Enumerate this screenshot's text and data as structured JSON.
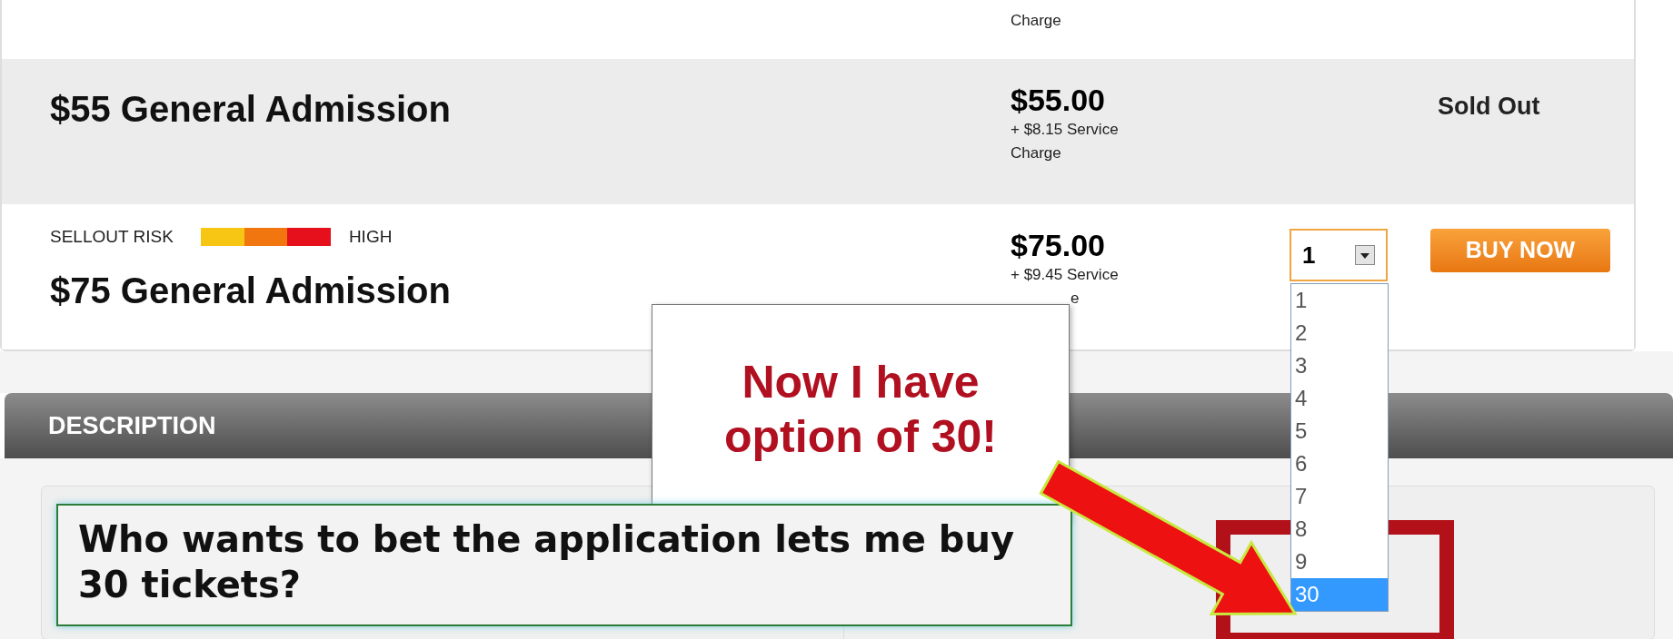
{
  "tickets": [
    {
      "kind": "partial",
      "fee_lines": [
        "Charge"
      ]
    },
    {
      "kind": "sold",
      "title": "$55 General Admission",
      "price": "$55.00",
      "fee_lines": [
        "+ $8.15 Service",
        "Charge"
      ],
      "status": "Sold Out"
    },
    {
      "kind": "buy",
      "risk_label": "SELLOUT RISK",
      "risk_level": "HIGH",
      "title": "$75 General Admission",
      "price": "$75.00",
      "fee_lines": [
        "+ $9.45 Service",
        "e"
      ],
      "quantity": "1",
      "button": "BUY NOW"
    }
  ],
  "quantity_options": [
    {
      "label": "1",
      "selected": false
    },
    {
      "label": "2",
      "selected": false
    },
    {
      "label": "3",
      "selected": false
    },
    {
      "label": "4",
      "selected": false
    },
    {
      "label": "5",
      "selected": false
    },
    {
      "label": "6",
      "selected": false
    },
    {
      "label": "7",
      "selected": false
    },
    {
      "label": "8",
      "selected": false
    },
    {
      "label": "9",
      "selected": false
    },
    {
      "label": "30",
      "selected": true
    }
  ],
  "description_header": "DESCRIPTION",
  "callout": [
    "Now I have",
    "option of 30!"
  ],
  "caption": "Who wants to bet the application lets me buy 30 tickets?"
}
